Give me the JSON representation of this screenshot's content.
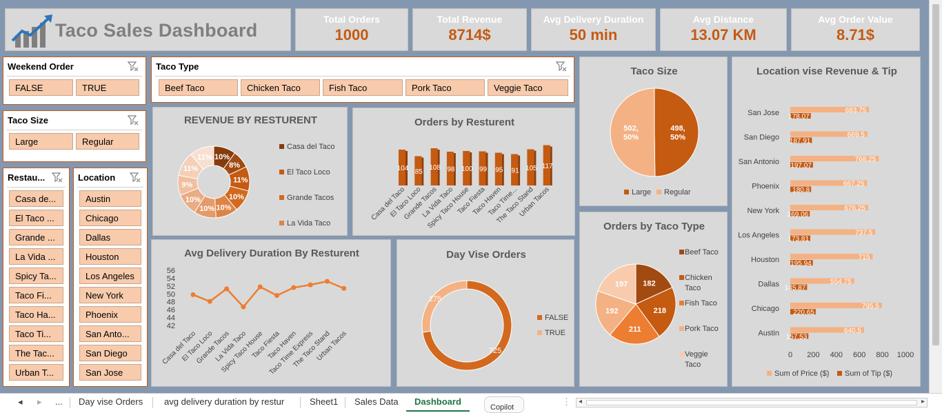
{
  "title": "Taco Sales Dashboard",
  "kpis": [
    {
      "label": "Total Orders",
      "value": "1000"
    },
    {
      "label": "Total Revenue",
      "value": "8714$"
    },
    {
      "label": "Avg Delivery Duration",
      "value": "50 min"
    },
    {
      "label": "Avg Distance",
      "value": "13.07 KM"
    },
    {
      "label": "Avg Order Value",
      "value": "8.71$"
    }
  ],
  "slicers": {
    "weekend": {
      "title": "Weekend Order",
      "items": [
        "FALSE",
        "TRUE"
      ]
    },
    "taco_type": {
      "title": "Taco Type",
      "items": [
        "Beef Taco",
        "Chicken Taco",
        "Fish Taco",
        "Pork Taco",
        "Veggie Taco"
      ]
    },
    "taco_size": {
      "title": "Taco Size",
      "items": [
        "Large",
        "Regular"
      ]
    },
    "restaurant": {
      "title": "Restau...",
      "items": [
        "Casa de...",
        "El Taco ...",
        "Grande ...",
        "La Vida ...",
        "Spicy Ta...",
        "Taco Fi...",
        "Taco Ha...",
        "Taco Ti...",
        "The Tac...",
        "Urban T..."
      ]
    },
    "location": {
      "title": "Location",
      "items": [
        "Austin",
        "Chicago",
        "Dallas",
        "Houston",
        "Los Angeles",
        "New York",
        "Phoenix",
        "San Anto...",
        "San Diego",
        "San Jose"
      ]
    }
  },
  "colors": {
    "accent": "#c55a11",
    "chip": "#f8cbad",
    "background": "#8497b0",
    "panel": "#d9d9d9"
  },
  "chart_data": [
    {
      "type": "pie",
      "title": "REVENUE BY RESTURENT",
      "legend": [
        "Casa del Taco",
        "El Taco Loco",
        "Grande Tacos",
        "La Vida Taco"
      ],
      "labels": [
        "10%",
        "8%",
        "11%",
        "10%",
        "10%",
        "10%",
        "10%",
        "9%",
        "11%",
        "11%"
      ],
      "values": [
        10,
        8,
        11,
        10,
        10,
        10,
        10,
        9,
        11,
        11
      ],
      "colors": [
        "#843c0c",
        "#a14a12",
        "#c55a11",
        "#d2691e",
        "#de8346",
        "#e59a6a",
        "#eaac84",
        "#f0bfa0",
        "#f4d0b9",
        "#f8e0d0"
      ]
    },
    {
      "type": "bar",
      "title": "Orders by Resturent",
      "categories": [
        "Casa del Taco",
        "El Taco Loco",
        "Grande Tacos",
        "La Vida Taco",
        "Spicy Taco House",
        "Taco Fiesta",
        "Taco Haven",
        "Taco Time...",
        "The Taco Stand",
        "Urban Tacos"
      ],
      "values": [
        104,
        85,
        108,
        98,
        100,
        99,
        95,
        91,
        105,
        117
      ]
    },
    {
      "type": "pie",
      "title": "Taco Size",
      "labels": [
        "498,\n50%",
        "502,\n50%"
      ],
      "values": [
        498,
        502
      ],
      "legend": [
        "Large",
        "Regular"
      ],
      "colors": [
        "#c55a11",
        "#f4b183"
      ]
    },
    {
      "type": "line",
      "title": "Avg Delivery Duration By Resturent",
      "categories": [
        "Casa del Taco",
        "El Taco Loco",
        "Grande Tacos",
        "La Vida Taco",
        "Spicy Taco House",
        "Taco Fiesta",
        "Taco Haven",
        "Taco Time Express",
        "The Taco Stand",
        "Urban Tacos"
      ],
      "values": [
        49.8,
        48.1,
        51.3,
        46.7,
        51.8,
        49.6,
        51.6,
        52.3,
        53.2,
        51.4
      ],
      "y_ticks": [
        "56",
        "54",
        "52",
        "50",
        "48",
        "46",
        "44",
        "42"
      ],
      "ylim": [
        42,
        56
      ]
    },
    {
      "type": "pie",
      "title": "Day Vise Orders",
      "labels": [
        "275",
        "725"
      ],
      "values": [
        275,
        725
      ],
      "legend": [
        "FALSE",
        "TRUE"
      ],
      "colors": [
        "#f4b183",
        "#d2691e"
      ]
    },
    {
      "type": "pie",
      "title": "Orders by Taco Type",
      "labels": [
        "182",
        "218",
        "211",
        "192",
        "197"
      ],
      "values": [
        182,
        218,
        211,
        192,
        197
      ],
      "legend": [
        "Beef Taco",
        "Chicken Taco",
        "Fish Taco",
        "Pork Taco",
        "Veggie Taco"
      ],
      "colors": [
        "#a14a12",
        "#c55a11",
        "#ed7d31",
        "#f4b183",
        "#f8cbad"
      ]
    },
    {
      "type": "bar",
      "title": "Location vise Revenue & Tip",
      "categories": [
        "San Jose",
        "San Diego",
        "San Antonio",
        "Phoenix",
        "New York",
        "Los Angeles",
        "Houston",
        "Dallas",
        "Chicago",
        "Austin"
      ],
      "series": [
        {
          "name": "Sum of Price ($)",
          "values": [
            683.75,
            669.5,
            768.25,
            667.25,
            676.25,
            737.5,
            715,
            554.75,
            795.5,
            640.5
          ]
        },
        {
          "name": "Sum of Tip ($)",
          "values": [
            178.07,
            187.91,
            197.07,
            180.8,
            169.06,
            173.81,
            195.94,
            145.87,
            220.65,
            157.53
          ]
        }
      ],
      "x_ticks": [
        "0",
        "200",
        "400",
        "600",
        "800",
        "1000"
      ],
      "xlim": [
        0,
        1000
      ],
      "colors": [
        "#f4b183",
        "#c55a11"
      ]
    }
  ],
  "tabs": {
    "nav_prev": "◂",
    "nav_next": "▸",
    "more": "...",
    "items": [
      "Day vise Orders",
      "avg delivery duration by restur",
      "Sheet1",
      "Sales Data",
      "Dashboard"
    ],
    "active": "Dashboard",
    "copilot": "Copilot"
  }
}
